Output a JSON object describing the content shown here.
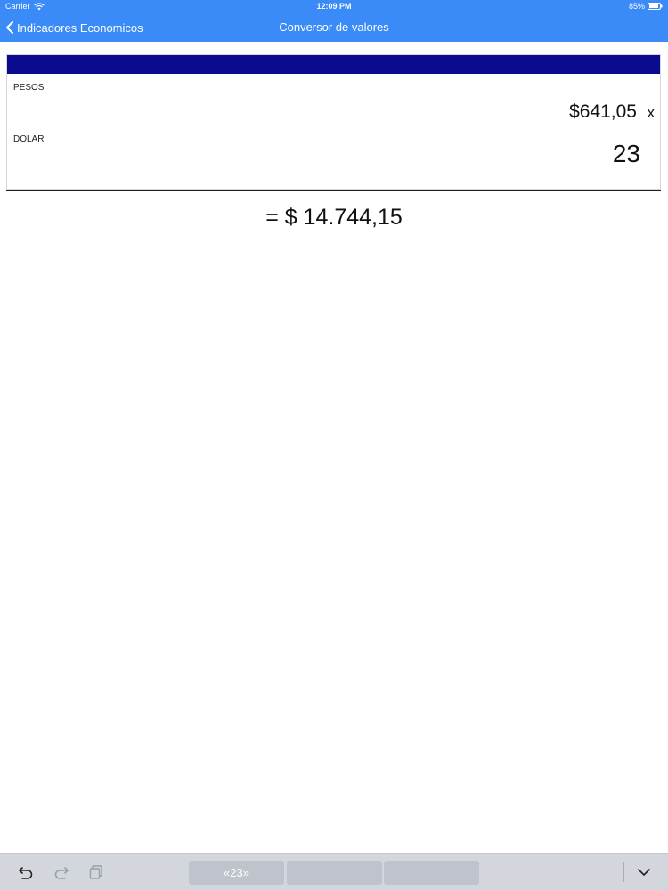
{
  "status_bar": {
    "carrier": "Carrier",
    "time": "12:09 PM",
    "battery": "85%",
    "icons": [
      "wifi-icon",
      "battery-icon"
    ]
  },
  "nav": {
    "back_label": "Indicadores Economicos",
    "title": "Conversor de valores",
    "back_icon": "chevron-left-icon"
  },
  "converter": {
    "pesos_label": "PESOS",
    "pesos_value": "$641,05",
    "times_sign": "x",
    "dolar_label": "DOLAR",
    "dolar_input_value": "23",
    "result": "= $ 14.744,15"
  },
  "keyboard_bar": {
    "icons": [
      "undo-icon",
      "redo-icon",
      "paste-icon",
      "keyboard-dismiss-icon"
    ],
    "suggestions": [
      "«23»",
      "",
      ""
    ]
  },
  "colors": {
    "nav_blue": "#3a8bf7",
    "card_header": "#0a0a8c",
    "keyboard_bar": "#d3d6dd"
  }
}
